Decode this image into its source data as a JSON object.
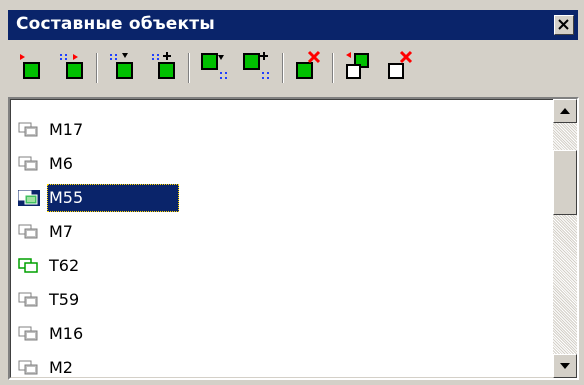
{
  "window": {
    "title": "Составные объекты",
    "close_icon": "close-icon"
  },
  "toolbar": {
    "buttons": [
      {
        "icon": "move-down-icon"
      },
      {
        "icon": "move-down-multiple-icon"
      },
      {
        "icon": "add-after-icon"
      },
      {
        "icon": "add-plus-icon"
      },
      {
        "icon": "group-arrow-icon"
      },
      {
        "icon": "group-plus-icon"
      },
      {
        "icon": "delete-object-icon"
      },
      {
        "icon": "ungroup-icon"
      },
      {
        "icon": "remove-outline-icon"
      }
    ]
  },
  "list": {
    "selected_index": 2,
    "items": [
      {
        "label": "M17",
        "icon": "composite-object-icon"
      },
      {
        "label": "M6",
        "icon": "composite-object-icon"
      },
      {
        "label": "M55",
        "icon": "composite-object-icon"
      },
      {
        "label": "M7",
        "icon": "composite-object-icon"
      },
      {
        "label": "T62",
        "icon": "composite-object-green-icon"
      },
      {
        "label": "T59",
        "icon": "composite-object-icon"
      },
      {
        "label": "M16",
        "icon": "composite-object-icon"
      },
      {
        "label": "M2",
        "icon": "composite-object-icon"
      }
    ]
  },
  "colors": {
    "selection": "#0a246a",
    "titlebar": "#0a246a",
    "panel": "#d4d0c8",
    "green": "#00c000",
    "red": "#ff0000",
    "blue": "#2040ff"
  }
}
